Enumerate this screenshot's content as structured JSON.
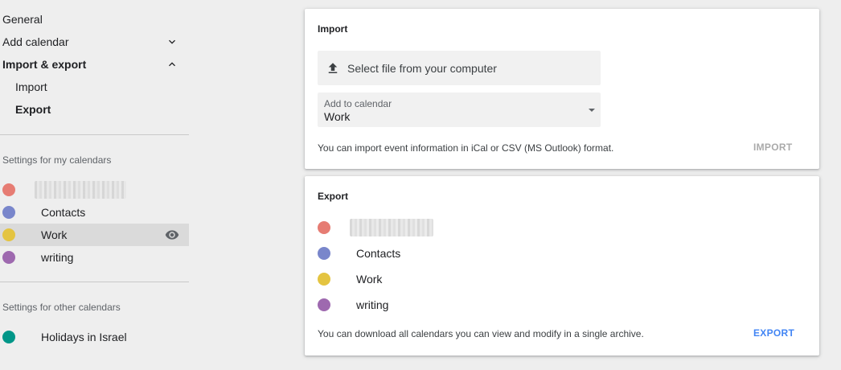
{
  "colors": {
    "pink": "#e67c73",
    "blue": "#7986cb",
    "yellow": "#e4c441",
    "purple": "#9e69af",
    "teal": "#009688",
    "accent": "#4285f4",
    "disabled": "#aaaaaa"
  },
  "sidebar": {
    "items": [
      {
        "label": "General"
      },
      {
        "label": "Add calendar",
        "icon": "chevron-down-icon"
      },
      {
        "label": "Import & export",
        "icon": "chevron-up-icon"
      },
      {
        "label": "Import"
      },
      {
        "label": "Export"
      }
    ],
    "my_calendars_heading": "Settings for my calendars",
    "my_calendars": [
      {
        "name": "",
        "color": "#e67c73",
        "blurred": true
      },
      {
        "name": "Contacts",
        "color": "#7986cb"
      },
      {
        "name": "Work",
        "color": "#e4c441",
        "selected": true,
        "icon": "eye-icon"
      },
      {
        "name": "writing",
        "color": "#9e69af"
      }
    ],
    "other_calendars_heading": "Settings for other calendars",
    "other_calendars": [
      {
        "name": "Holidays in Israel",
        "color": "#009688"
      }
    ]
  },
  "import_card": {
    "title": "Import",
    "file_button_label": "Select file from your computer",
    "file_icon": "upload-icon",
    "select_label": "Add to calendar",
    "select_value": "Work",
    "note": "You can import event information in iCal or CSV (MS Outlook) format.",
    "action_label": "IMPORT"
  },
  "export_card": {
    "title": "Export",
    "calendars": [
      {
        "name": "",
        "color": "#e67c73",
        "blurred": true
      },
      {
        "name": "Contacts",
        "color": "#7986cb"
      },
      {
        "name": "Work",
        "color": "#e4c441"
      },
      {
        "name": "writing",
        "color": "#9e69af"
      }
    ],
    "note": "You can download all calendars you can view and modify in a single archive.",
    "action_label": "EXPORT"
  }
}
